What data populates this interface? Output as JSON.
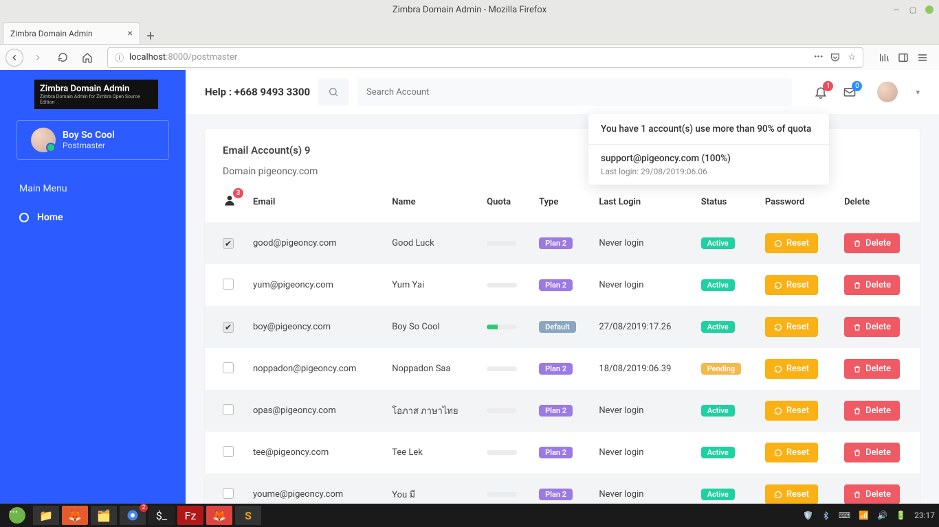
{
  "os": {
    "title": "Zimbra Domain Admin - Mozilla Firefox"
  },
  "browser": {
    "tab_title": "Zimbra Domain Admin",
    "url_host": "localhost",
    "url_port_path": ":8000/postmaster"
  },
  "sidebar": {
    "logo_title": "Zimbra Domain Admin",
    "logo_sub": "Zimbra Domain Admin for Zimbra Open Source Edition",
    "profile_name": "Boy So Cool",
    "profile_role": "Postmaster",
    "menu_header": "Main Menu",
    "items": [
      {
        "label": "Home"
      }
    ]
  },
  "topbar": {
    "help": "Help : +668 9493 3300",
    "search_placeholder": "Search Account",
    "bell_count": "1",
    "mail_count": "0"
  },
  "popup": {
    "header": "You have 1 account(s) use more than 90% of quota",
    "email": "support@pigeoncy.com (100%)",
    "sub": "Last login: 29/08/2019:06.06"
  },
  "card": {
    "title": "Email Account(s) 9",
    "domain": "Domain pigeoncy.com",
    "badge": "3",
    "headers": {
      "email": "Email",
      "name": "Name",
      "quota": "Quota",
      "type": "Type",
      "last": "Last Login",
      "status": "Status",
      "password": "Password",
      "delete": "Delete"
    },
    "reset_label": "Reset",
    "delete_label": "Delete",
    "rows": [
      {
        "checked": true,
        "email": "good@pigeoncy.com",
        "name": "Good Luck",
        "quota_pct": 0,
        "type": "Plan 2",
        "type_cls": "plan2",
        "last": "Never login",
        "status": "Active",
        "status_cls": "active"
      },
      {
        "checked": false,
        "email": "yum@pigeoncy.com",
        "name": "Yum Yai",
        "quota_pct": 0,
        "type": "Plan 2",
        "type_cls": "plan2",
        "last": "Never login",
        "status": "Active",
        "status_cls": "active"
      },
      {
        "checked": true,
        "email": "boy@pigeoncy.com",
        "name": "Boy So Cool",
        "quota_pct": 35,
        "type": "Default",
        "type_cls": "default",
        "last": "27/08/2019:17.26",
        "status": "Active",
        "status_cls": "active"
      },
      {
        "checked": false,
        "email": "noppadon@pigeoncy.com",
        "name": "Noppadon Saa",
        "quota_pct": 0,
        "type": "Plan 2",
        "type_cls": "plan2",
        "last": "18/08/2019:06.39",
        "status": "Pending",
        "status_cls": "pending"
      },
      {
        "checked": false,
        "email": "opas@pigeoncy.com",
        "name": "โอภาส ภาษาไทย",
        "quota_pct": 0,
        "type": "Plan 2",
        "type_cls": "plan2",
        "last": "Never login",
        "status": "Active",
        "status_cls": "active"
      },
      {
        "checked": false,
        "email": "tee@pigeoncy.com",
        "name": "Tee Lek",
        "quota_pct": 0,
        "type": "Plan 2",
        "type_cls": "plan2",
        "last": "Never login",
        "status": "Active",
        "status_cls": "active"
      },
      {
        "checked": false,
        "email": "youme@pigeoncy.com",
        "name": "You มี",
        "quota_pct": 0,
        "type": "Plan 2",
        "type_cls": "plan2",
        "last": "Never login",
        "status": "Active",
        "status_cls": "active"
      }
    ]
  },
  "taskbar": {
    "chrome_badge": "2",
    "clock": "23:17"
  }
}
